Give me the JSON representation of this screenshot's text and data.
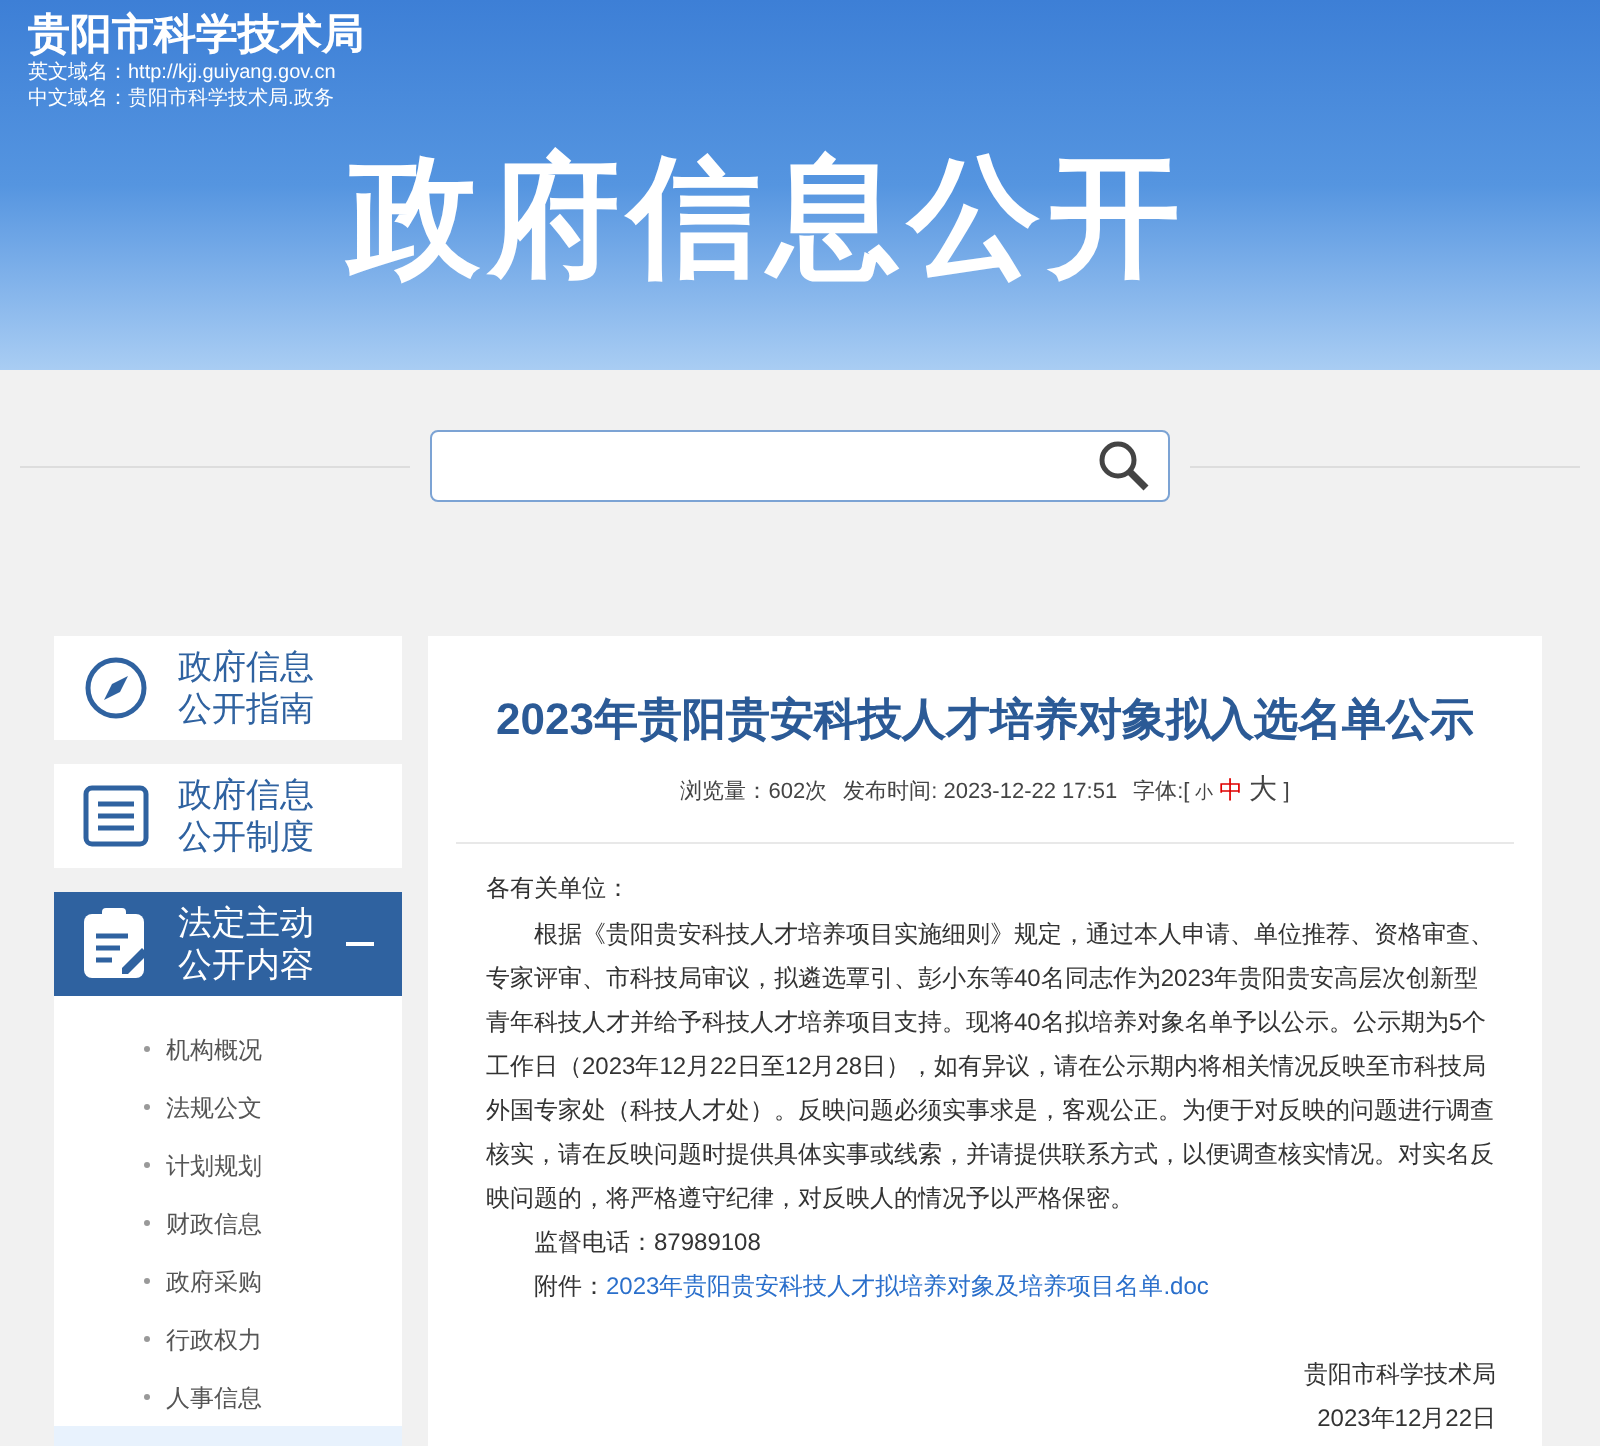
{
  "header": {
    "site_name": "贵阳市科学技术局",
    "domain_en": "英文域名：http://kjj.guiyang.gov.cn",
    "domain_zh": "中文域名：贵阳市科学技术局.政务",
    "banner_title": "政府信息公开"
  },
  "sidebar": {
    "items": [
      {
        "kind": "compass",
        "label_1": "政府信息",
        "label_2": "公开指南",
        "selected": false
      },
      {
        "kind": "list",
        "label_1": "政府信息",
        "label_2": "公开制度",
        "selected": false
      },
      {
        "kind": "clipboard",
        "label_1": "法定主动",
        "label_2": "公开内容",
        "selected": true,
        "expanded": true,
        "children": [
          {
            "label": "机构概况",
            "selected": false
          },
          {
            "label": "法规公文",
            "selected": false
          },
          {
            "label": "计划规划",
            "selected": false
          },
          {
            "label": "财政信息",
            "selected": false
          },
          {
            "label": "政府采购",
            "selected": false
          },
          {
            "label": "行政权力",
            "selected": false
          },
          {
            "label": "人事信息",
            "selected": false
          },
          {
            "selected": true
          }
        ]
      }
    ]
  },
  "article": {
    "title": "2023年贵阳贵安科技人才培养对象拟入选名单公示",
    "views": "浏览量：602次",
    "published": "发布时间: 2023-12-22 17:51",
    "font_label": "字体:[",
    "font_sizes": [
      {
        "label": "小",
        "selected": false
      },
      {
        "label": "中",
        "selected": true
      },
      {
        "label": "大",
        "selected": false
      }
    ],
    "font_close": "]",
    "salutation": "各有关单位：",
    "body": "根据《贵阳贵安科技人才培养项目实施细则》规定，通过本人申请、单位推荐、资格审查、专家评审、市科技局审议，拟遴选覃引、彭小东等40名同志作为2023年贵阳贵安高层次创新型青年科技人才并给予科技人才培养项目支持。现将40名拟培养对象名单予以公示。公示期为5个工作日（2023年12月22日至12月28日），如有异议，请在公示期内将相关情况反映至市科技局外国专家处（科技人才处）。反映问题必须实事求是，客观公正。为便于对反映的问题进行调查核实，请在反映问题时提供具体实事或线索，并请提供联系方式，以便调查核实情况。对实名反映问题的，将严格遵守纪律，对反映人的情况予以严格保密。",
    "phone": "监督电话：87989108",
    "attachment_label": "附件：",
    "attachment_link": "2023年贵阳贵安科技人才拟培养对象及培养项目名单.doc",
    "signature": "贵阳市科学技术局",
    "date": "2023年12月22日"
  }
}
